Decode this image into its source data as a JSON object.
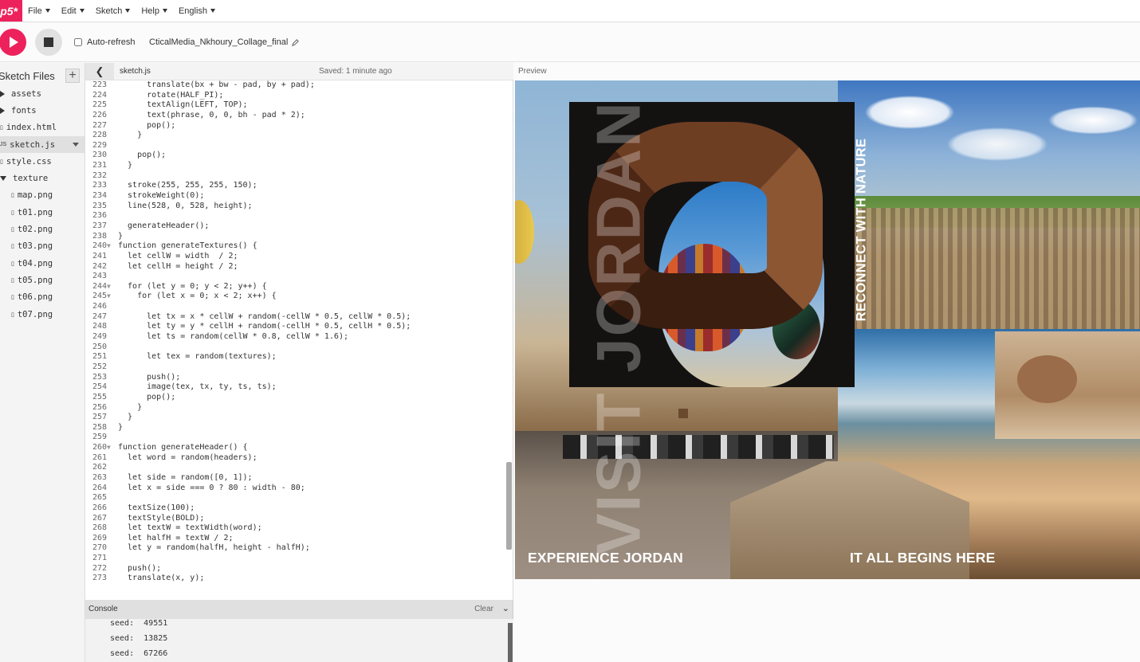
{
  "app": {
    "logo": "p5*",
    "menu": [
      {
        "label": "File"
      },
      {
        "label": "Edit"
      },
      {
        "label": "Sketch"
      },
      {
        "label": "Help"
      },
      {
        "label": "English"
      }
    ],
    "brand_color": "#ed225d"
  },
  "toolbar": {
    "play_icon": "play-icon",
    "stop_icon": "stop-icon",
    "autorefresh_label": "Auto-refresh",
    "autorefresh_checked": false,
    "project_name": "CticalMedia_Nkhoury_Collage_final",
    "edit_icon": "pencil-icon"
  },
  "sidebar": {
    "title": "Sketch Files",
    "add_label": "+",
    "files": [
      {
        "name": "assets",
        "type": "folder",
        "expanded": false,
        "indent": 0
      },
      {
        "name": "fonts",
        "type": "folder",
        "expanded": false,
        "indent": 0
      },
      {
        "name": "index.html",
        "type": "file",
        "icon": "file-icon",
        "indent": 0
      },
      {
        "name": "sketch.js",
        "type": "file",
        "icon": "js-file-icon",
        "indent": 0,
        "selected": true
      },
      {
        "name": "style.css",
        "type": "file",
        "icon": "file-icon",
        "indent": 0
      },
      {
        "name": "texture",
        "type": "folder",
        "expanded": true,
        "indent": 0
      },
      {
        "name": "map.png",
        "type": "file",
        "icon": "file-icon",
        "indent": 1
      },
      {
        "name": "t01.png",
        "type": "file",
        "icon": "file-icon",
        "indent": 1
      },
      {
        "name": "t02.png",
        "type": "file",
        "icon": "file-icon",
        "indent": 1
      },
      {
        "name": "t03.png",
        "type": "file",
        "icon": "file-icon",
        "indent": 1
      },
      {
        "name": "t04.png",
        "type": "file",
        "icon": "file-icon",
        "indent": 1
      },
      {
        "name": "t05.png",
        "type": "file",
        "icon": "file-icon",
        "indent": 1
      },
      {
        "name": "t06.png",
        "type": "file",
        "icon": "file-icon",
        "indent": 1
      },
      {
        "name": "t07.png",
        "type": "file",
        "icon": "file-icon",
        "indent": 1
      }
    ]
  },
  "editor": {
    "tab_name": "sketch.js",
    "saved_status": "Saved: 1 minute ago",
    "lines": [
      {
        "n": "223",
        "fold": "",
        "t": "      translate(bx + bw - pad, by + pad);"
      },
      {
        "n": "224",
        "fold": "",
        "t": "      rotate(HALF_PI);"
      },
      {
        "n": "225",
        "fold": "",
        "t": "      textAlign(LEFT, TOP);"
      },
      {
        "n": "226",
        "fold": "",
        "t": "      text(phrase, 0, 0, bh - pad * 2);"
      },
      {
        "n": "227",
        "fold": "",
        "t": "      pop();"
      },
      {
        "n": "228",
        "fold": "",
        "t": "    }"
      },
      {
        "n": "229",
        "fold": "",
        "t": ""
      },
      {
        "n": "230",
        "fold": "",
        "t": "    pop();"
      },
      {
        "n": "231",
        "fold": "",
        "t": "  }"
      },
      {
        "n": "232",
        "fold": "",
        "t": ""
      },
      {
        "n": "233",
        "fold": "",
        "t": "  stroke(255, 255, 255, 150);"
      },
      {
        "n": "234",
        "fold": "",
        "t": "  strokeWeight(0);"
      },
      {
        "n": "235",
        "fold": "",
        "t": "  line(528, 0, 528, height);"
      },
      {
        "n": "236",
        "fold": "",
        "t": ""
      },
      {
        "n": "237",
        "fold": "",
        "t": "  generateHeader();"
      },
      {
        "n": "238",
        "fold": "",
        "t": "}"
      },
      {
        "n": "240",
        "fold": "▼",
        "t": "function generateTextures() {"
      },
      {
        "n": "241",
        "fold": "",
        "t": "  let cellW = width  / 2;"
      },
      {
        "n": "242",
        "fold": "",
        "t": "  let cellH = height / 2;"
      },
      {
        "n": "243",
        "fold": "",
        "t": ""
      },
      {
        "n": "244",
        "fold": "▼",
        "t": "  for (let y = 0; y < 2; y++) {"
      },
      {
        "n": "245",
        "fold": "▼",
        "t": "    for (let x = 0; x < 2; x++) {"
      },
      {
        "n": "246",
        "fold": "",
        "t": ""
      },
      {
        "n": "247",
        "fold": "",
        "t": "      let tx = x * cellW + random(-cellW * 0.5, cellW * 0.5);"
      },
      {
        "n": "248",
        "fold": "",
        "t": "      let ty = y * cellH + random(-cellH * 0.5, cellH * 0.5);"
      },
      {
        "n": "249",
        "fold": "",
        "t": "      let ts = random(cellW * 0.8, cellW * 1.6);"
      },
      {
        "n": "250",
        "fold": "",
        "t": ""
      },
      {
        "n": "251",
        "fold": "",
        "t": "      let tex = random(textures);"
      },
      {
        "n": "252",
        "fold": "",
        "t": ""
      },
      {
        "n": "253",
        "fold": "",
        "t": "      push();"
      },
      {
        "n": "254",
        "fold": "",
        "t": "      image(tex, tx, ty, ts, ts);"
      },
      {
        "n": "255",
        "fold": "",
        "t": "      pop();"
      },
      {
        "n": "256",
        "fold": "",
        "t": "    }"
      },
      {
        "n": "257",
        "fold": "",
        "t": "  }"
      },
      {
        "n": "258",
        "fold": "",
        "t": "}"
      },
      {
        "n": "259",
        "fold": "",
        "t": ""
      },
      {
        "n": "260",
        "fold": "▼",
        "t": "function generateHeader() {"
      },
      {
        "n": "261",
        "fold": "",
        "t": "  let word = random(headers);"
      },
      {
        "n": "262",
        "fold": "",
        "t": ""
      },
      {
        "n": "263",
        "fold": "",
        "t": "  let side = random([0, 1]);"
      },
      {
        "n": "264",
        "fold": "",
        "t": "  let x = side === 0 ? 80 : width - 80;"
      },
      {
        "n": "265",
        "fold": "",
        "t": ""
      },
      {
        "n": "266",
        "fold": "",
        "t": "  textSize(100);"
      },
      {
        "n": "267",
        "fold": "",
        "t": "  textStyle(BOLD);"
      },
      {
        "n": "268",
        "fold": "",
        "t": "  let textW = textWidth(word);"
      },
      {
        "n": "269",
        "fold": "",
        "t": "  let halfH = textW / 2;"
      },
      {
        "n": "270",
        "fold": "",
        "t": "  let y = random(halfH, height - halfH);"
      },
      {
        "n": "271",
        "fold": "",
        "t": ""
      },
      {
        "n": "272",
        "fold": "",
        "t": "  push();"
      },
      {
        "n": "273",
        "fold": "",
        "t": "  translate(x, y);"
      }
    ]
  },
  "console": {
    "title": "Console",
    "clear_label": "Clear",
    "lines": [
      {
        "label": "seed:",
        "value": "49551"
      },
      {
        "label": "seed:",
        "value": "13825"
      },
      {
        "label": "seed:",
        "value": "67266"
      }
    ]
  },
  "preview": {
    "title": "Preview",
    "vertical_bg_text": "VISIT JORDAN",
    "vertical_text": "RECONNECT WITH NATURE",
    "caption_left": "EXPERIENCE JORDAN",
    "caption_right": "IT ALL BEGINS HERE"
  }
}
